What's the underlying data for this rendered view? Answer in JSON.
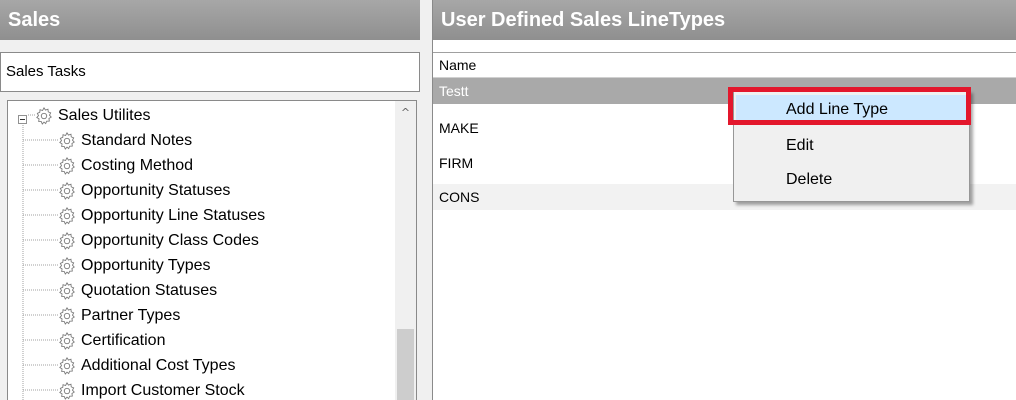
{
  "left_panel": {
    "title": "Sales",
    "tasks_label": "Sales Tasks",
    "tree": {
      "root": {
        "label": "Sales Utilites",
        "icon": "gear-icon",
        "expanded": true
      },
      "children": [
        {
          "label": "Standard Notes",
          "icon": "gear-icon"
        },
        {
          "label": "Costing Method",
          "icon": "gear-icon"
        },
        {
          "label": "Opportunity Statuses",
          "icon": "gear-icon"
        },
        {
          "label": "Opportunity Line Statuses",
          "icon": "gear-icon"
        },
        {
          "label": "Opportunity Class Codes",
          "icon": "gear-icon"
        },
        {
          "label": "Opportunity Types",
          "icon": "gear-icon"
        },
        {
          "label": "Quotation Statuses",
          "icon": "gear-icon"
        },
        {
          "label": "Partner Types",
          "icon": "gear-icon"
        },
        {
          "label": "Certification",
          "icon": "gear-icon"
        },
        {
          "label": "Additional Cost Types",
          "icon": "gear-icon"
        },
        {
          "label": "Import Customer Stock",
          "icon": "gear-icon"
        }
      ]
    },
    "scroll_up_glyph": "^"
  },
  "right_panel": {
    "title": "User Defined Sales LineTypes",
    "column_header": "Name",
    "rows": [
      {
        "name": "Testt",
        "selected": true
      },
      {
        "name": "MAKE",
        "selected": false
      },
      {
        "name": "FIRM",
        "selected": false
      },
      {
        "name": "CONS",
        "selected": false
      }
    ]
  },
  "context_menu": {
    "items": [
      {
        "label": "Add Line Type",
        "highlighted": true
      },
      {
        "label": "Edit",
        "highlighted": false
      },
      {
        "label": "Delete",
        "highlighted": false
      }
    ]
  },
  "colors": {
    "header_gray": "#999999",
    "selected_row": "#a9a9a9",
    "menu_highlight": "#cce8ff",
    "annotation_red": "#e3172c"
  }
}
